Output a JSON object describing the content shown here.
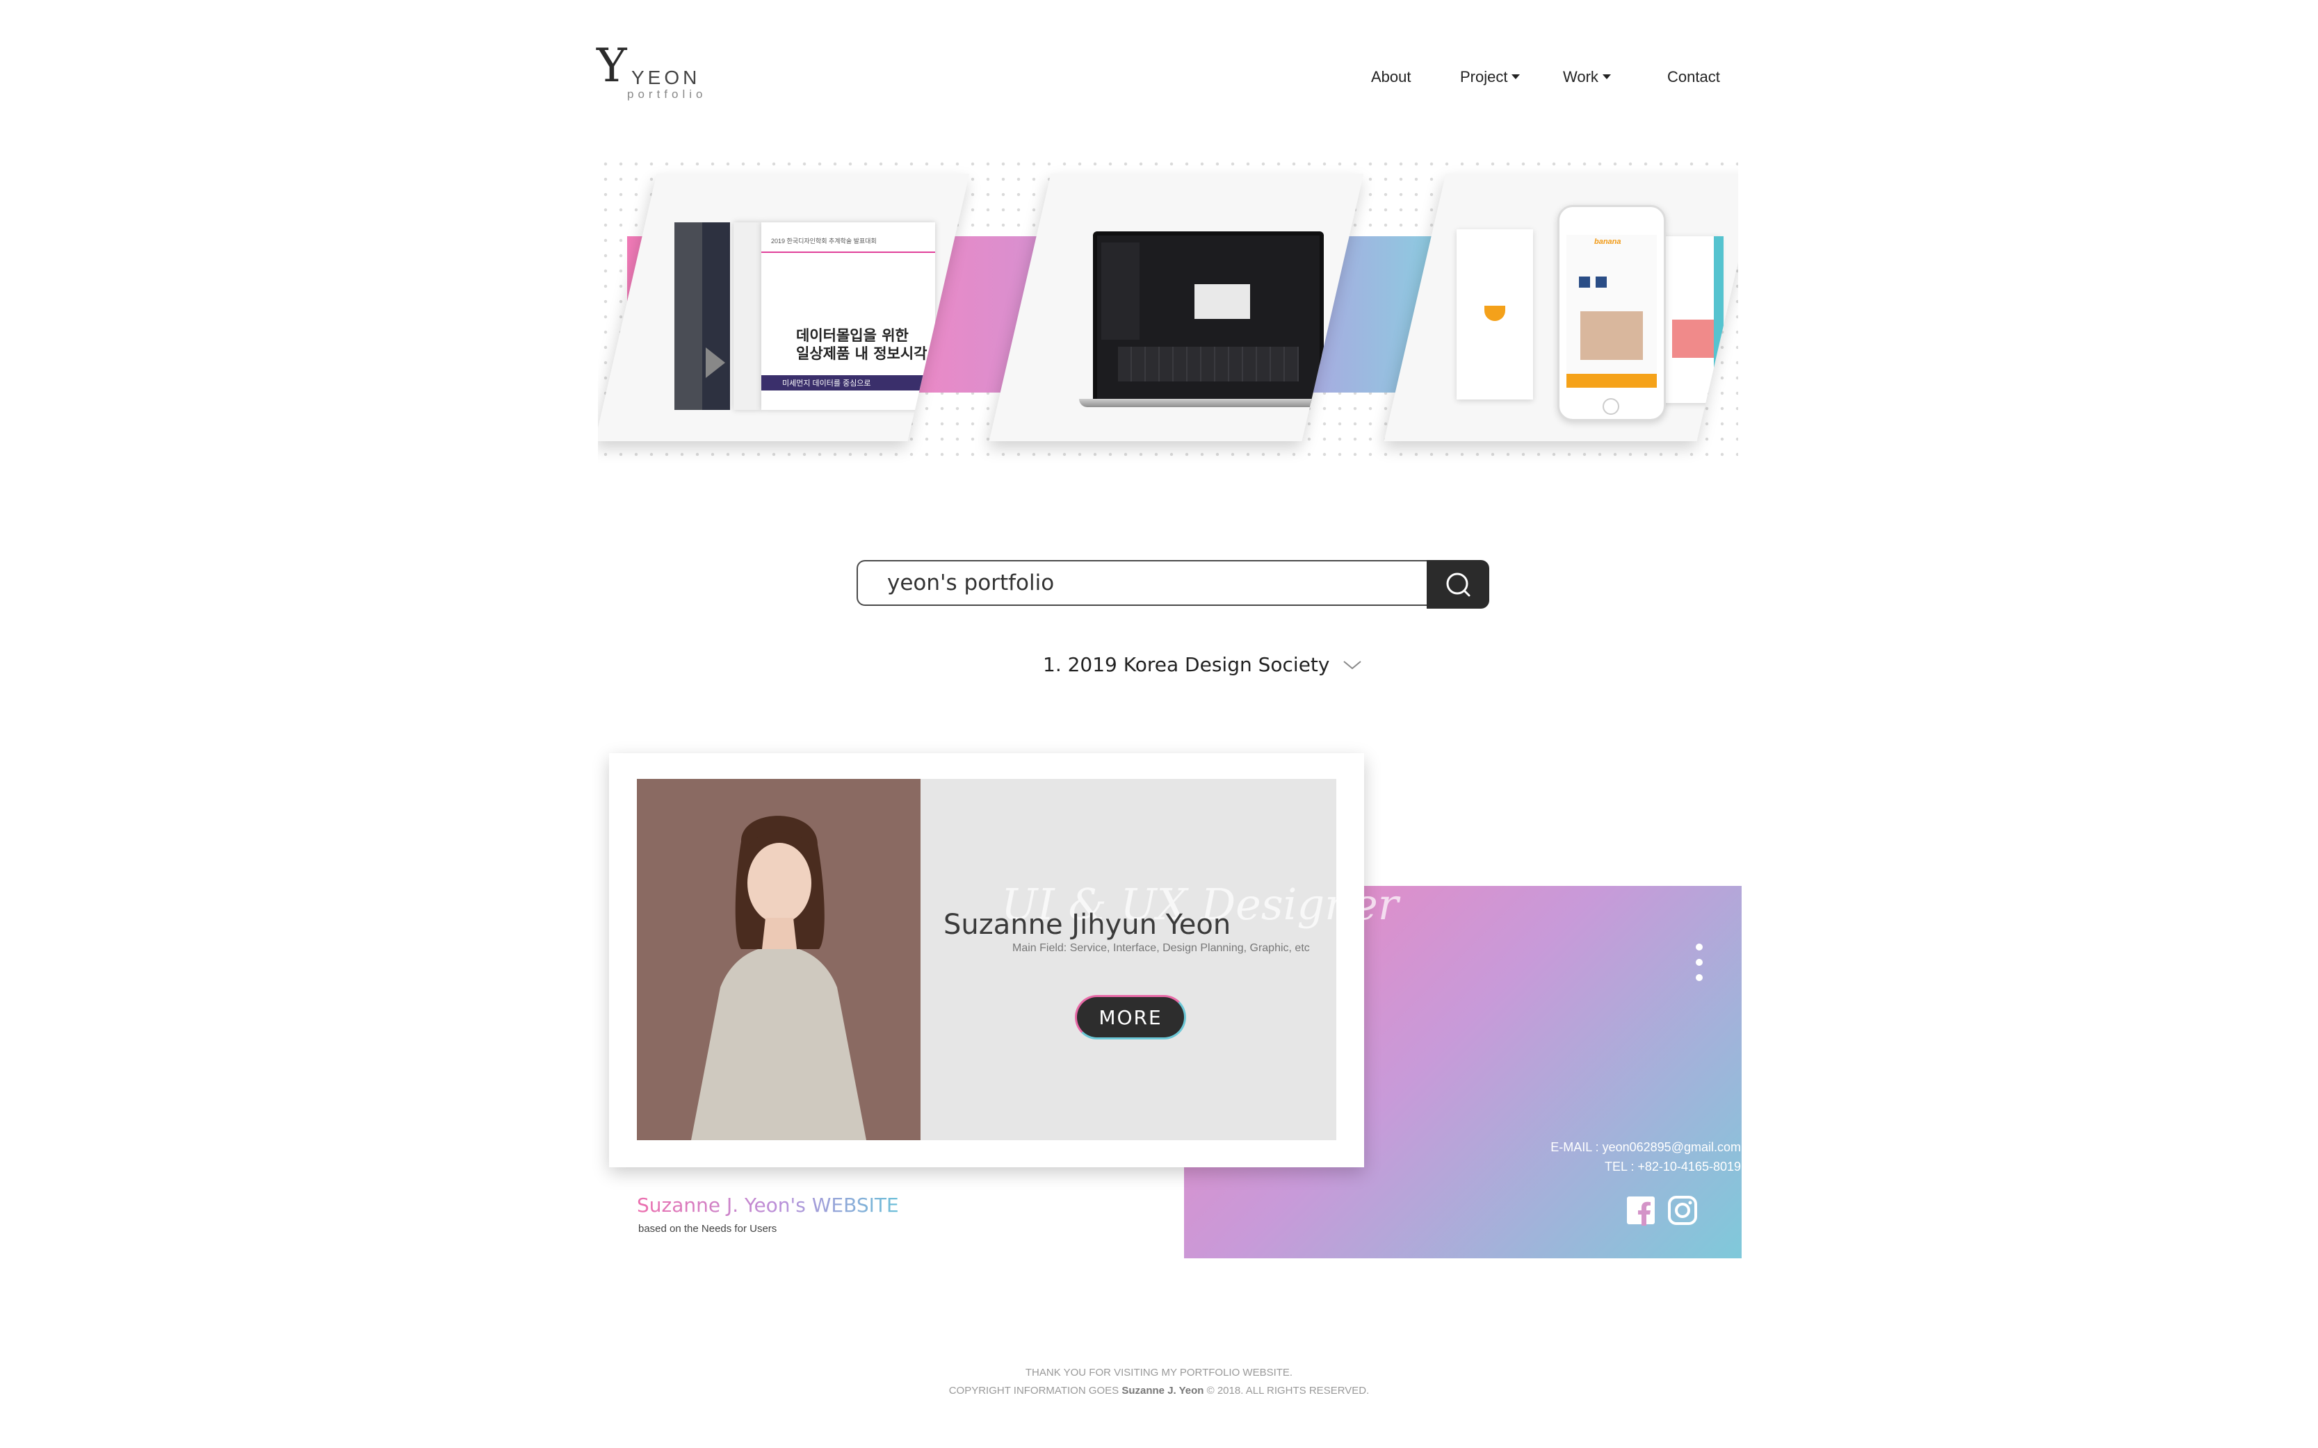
{
  "header": {
    "logo": {
      "letter": "Y",
      "name": "YEON",
      "sub": "portfolio"
    },
    "nav": [
      {
        "label": "About",
        "has_caret": false
      },
      {
        "label": "Project",
        "has_caret": true
      },
      {
        "label": "Work",
        "has_caret": true
      },
      {
        "label": "Contact",
        "has_caret": false
      }
    ]
  },
  "banner": {
    "doc_title_line1": "데이터몰입을 위한",
    "doc_title_line2": "일상제품 내 정보시각",
    "doc_band": "미세먼지 데이터를 중심으로",
    "doc_header": "2019 한국디자인학회 추계학술 발표대회",
    "app_brand": "banana"
  },
  "search": {
    "value": "yeon's portfolio",
    "icon": "search-icon"
  },
  "dropdown": {
    "label": "1. 2019 Korea Design Society",
    "icon": "chevron-down-icon"
  },
  "profile": {
    "script": "UI & UX Designer",
    "name": "Suzanne Jihyun Yeon",
    "main_field": "Main Field: Service, Interface, Design Planning, Graphic, etc",
    "more": "MORE",
    "email": "E-MAIL : yeon062895@gmail.com",
    "tel": "TEL : +82-10-4165-8019",
    "site_title": "Suzanne J. Yeon's WEBSITE",
    "site_sub": "based on the Needs for Users"
  },
  "colors": {
    "pink": "#ec6fae",
    "purple": "#b98fd9",
    "teal": "#6bbfd8",
    "dark": "#2b2b2b"
  },
  "footer": {
    "line1": "THANK YOU FOR VISITING MY PORTFOLIO WEBSITE.",
    "line2_prefix": "COPYRIGHT INFORMATION GOES ",
    "line2_name": "Suzanne J. Yeon",
    "line2_suffix": " © 2018. ALL RIGHTS RESERVED."
  }
}
